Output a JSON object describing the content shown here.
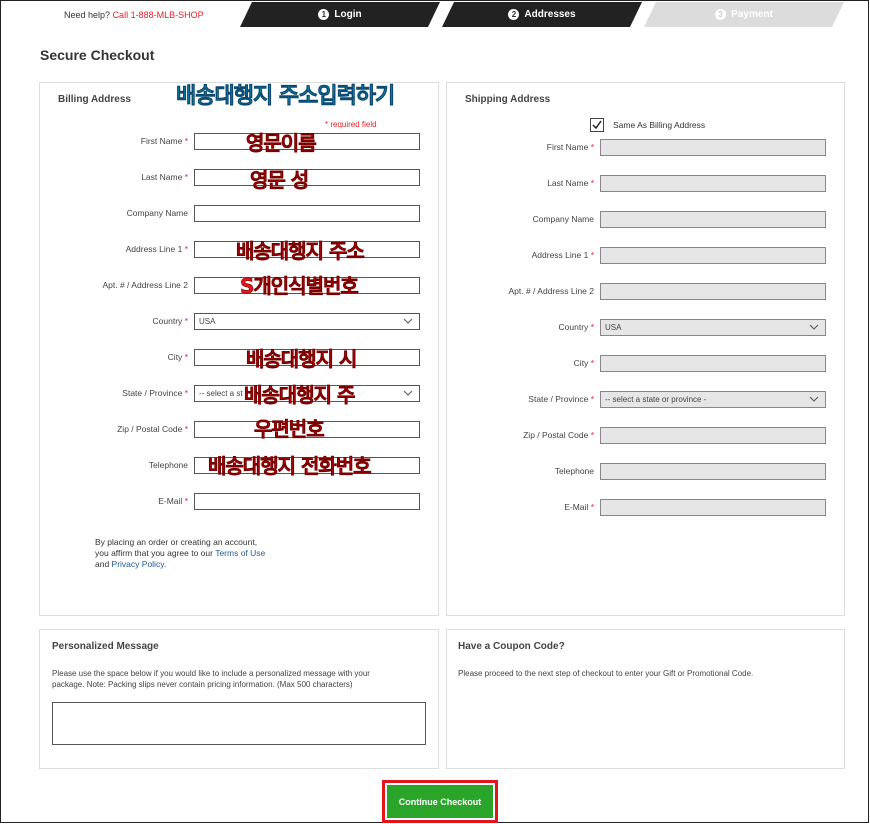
{
  "header": {
    "help_text": "Need help?",
    "help_phone": "Call 1-888-MLB-SHOP",
    "steps": [
      {
        "num": "1",
        "label": "Login"
      },
      {
        "num": "2",
        "label": "Addresses"
      },
      {
        "num": "3",
        "label": "Payment"
      }
    ]
  },
  "page_title": "Secure Checkout",
  "billing": {
    "title": "Billing Address",
    "required_note": "* required field",
    "fields": [
      {
        "label": "First Name",
        "required": "*",
        "value": ""
      },
      {
        "label": "Last Name",
        "required": "*",
        "value": ""
      },
      {
        "label": "Company Name",
        "required": "",
        "value": ""
      },
      {
        "label": "Address Line 1",
        "required": "*",
        "value": ""
      },
      {
        "label": "Apt. # / Address Line 2",
        "required": "",
        "value": ""
      },
      {
        "label": "Country",
        "required": "*",
        "value": "USA"
      },
      {
        "label": "City",
        "required": "*",
        "value": ""
      },
      {
        "label": "State / Province",
        "required": "*",
        "value": "-- select a st"
      },
      {
        "label": "Zip / Postal Code",
        "required": "*",
        "value": ""
      },
      {
        "label": "Telephone",
        "required": "",
        "value": ""
      },
      {
        "label": "E-Mail",
        "required": "*",
        "value": ""
      }
    ],
    "legal_line1": "By placing an order or creating an account,",
    "legal_line2_pre": "you affirm that you agree to our ",
    "terms_link": "Terms of Use",
    "legal_line3_pre": "and ",
    "privacy_link": "Privacy Policy",
    "legal_line3_post": "."
  },
  "shipping": {
    "title": "Shipping Address",
    "same_as_label": "Same As Billing Address",
    "same_as_checked": true,
    "fields": [
      {
        "label": "First Name",
        "required": "*",
        "value": ""
      },
      {
        "label": "Last Name",
        "required": "*",
        "value": ""
      },
      {
        "label": "Company Name",
        "required": "",
        "value": ""
      },
      {
        "label": "Address Line 1",
        "required": "*",
        "value": ""
      },
      {
        "label": "Apt. # / Address Line 2",
        "required": "",
        "value": ""
      },
      {
        "label": "Country",
        "required": "*",
        "value": "USA"
      },
      {
        "label": "City",
        "required": "*",
        "value": ""
      },
      {
        "label": "State / Province",
        "required": "*",
        "value": "-- select a state or province -"
      },
      {
        "label": "Zip / Postal Code",
        "required": "*",
        "value": ""
      },
      {
        "label": "Telephone",
        "required": "",
        "value": ""
      },
      {
        "label": "E-Mail",
        "required": "*",
        "value": ""
      }
    ]
  },
  "annotations": {
    "heading": "배송대행지 주소입력하기",
    "first_name": "영문이름",
    "last_name": "영문 성",
    "address1": "배송대행지 주소",
    "address2": "S개인식별번호",
    "city": "배송대행지 시",
    "state": "배송대행지 주",
    "zip": "우편번호",
    "telephone": "배송대행지 전화번호"
  },
  "message": {
    "title": "Personalized Message",
    "text1": "Please use the space below if you would like to include a personalized message with your",
    "text2": "package. Note: Packing slips never contain pricing information. (Max 500 characters)",
    "value": ""
  },
  "coupon": {
    "title": "Have a Coupon Code?",
    "text": "Please proceed to the next step of checkout to enter your Gift or Promotional Code."
  },
  "continue_label": "Continue Checkout",
  "colors": {
    "accent_red": "#e4212a",
    "button_green": "#2aa52a",
    "link_blue": "#1d5b9b",
    "step_active": "#222222",
    "step_inactive": "#dcdcdc"
  }
}
